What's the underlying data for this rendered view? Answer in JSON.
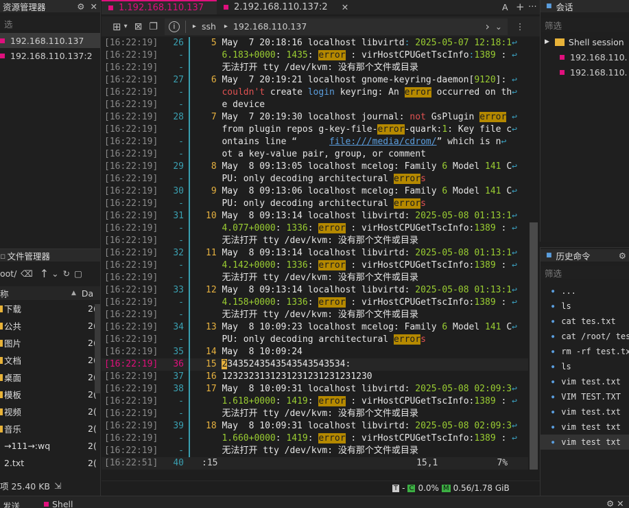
{
  "left_panel": {
    "title": "资源管理器",
    "filter": "选",
    "sessions": [
      "192.168.110.137",
      "192.168.110.137:2"
    ]
  },
  "file_manager": {
    "title": "文件管理器",
    "path": "oot/",
    "col_name": "称",
    "col_date": "Da",
    "items": [
      {
        "name": "下载",
        "date": "2("
      },
      {
        "name": "公共",
        "date": "2("
      },
      {
        "name": "图片",
        "date": "2("
      },
      {
        "name": "文档",
        "date": "2("
      },
      {
        "name": "桌面",
        "date": "2("
      },
      {
        "name": "模板",
        "date": "2("
      },
      {
        "name": "视频",
        "date": "2("
      },
      {
        "name": "音乐",
        "date": "2("
      },
      {
        "name": "→111→:wq",
        "date": "2("
      },
      {
        "name": "2.txt",
        "date": "2("
      }
    ],
    "status": "项 25.40 KB"
  },
  "bottom_tabs": [
    "发送",
    "Shell"
  ],
  "tabs": [
    {
      "label": "1.192.168.110.137",
      "active": true
    },
    {
      "label": "2.192.168.110.137:2",
      "active": false
    }
  ],
  "tab_bar_right": "A",
  "address": {
    "protocol": "ssh",
    "host": "192.168.110.137"
  },
  "terminal": {
    "lines": [
      {
        "ts": "[16:22:19]",
        "ln": "26",
        "html": "<span class='n'> 5</span> May  7 20:18:16 localhost libvirtd<span class='cyan'>:</span> <span class='grn'>2025-05-07 12:18:1</span><span class='wrap'>↩</span>"
      },
      {
        "ts": "[16:22:19]",
        "ln": "-",
        "html": "   <span class='grn'>6.183+0000</span>: <span class='grn'>1435</span>: <span class='er'>error</span> : virHostCPUGetTscInfo<span class='cyan'>:</span><span class='grn'>1389</span> : <span class='wrap'>↩</span>"
      },
      {
        "ts": "[16:22:19]",
        "ln": "-",
        "html": "   无法打开 tty /dev/kvm: 没有那个文件或目录"
      },
      {
        "ts": "[16:22:19]",
        "ln": "27",
        "html": "<span class='n'> 6</span> May  7 20:19:21 localhost gnome-keyring-daemon[<span class='grn'>9120</span>]: <span class='wrap'>↩</span>"
      },
      {
        "ts": "[16:22:19]",
        "ln": "-",
        "html": "   <span class='red'>couldn't</span> create <span class='blu'>login</span> keyring: An <span class='er'>error</span> occurred on th<span class='wrap'>↩</span>"
      },
      {
        "ts": "[16:22:19]",
        "ln": "-",
        "html": "   e device"
      },
      {
        "ts": "[16:22:19]",
        "ln": "28",
        "html": "<span class='n'> 7</span> May  7 20:19:30 localhost journal: <span class='red'>not</span> GsPlugin <span class='er'>error</span> <span class='wrap'>↩</span>"
      },
      {
        "ts": "[16:22:19]",
        "ln": "-",
        "html": "   from plugin repos g-key-file-<span class='er'>error</span>-quark:<span class='grn'>1</span>: Key file c<span class='wrap'>↩</span>"
      },
      {
        "ts": "[16:22:19]",
        "ln": "-",
        "html": "   ontains line “      <span class='link'>file:///media/cdrom/</span>” which is n<span class='wrap'>↩</span>"
      },
      {
        "ts": "[16:22:19]",
        "ln": "-",
        "html": "   ot a key-value pair, group, or comment"
      },
      {
        "ts": "[16:22:19]",
        "ln": "29",
        "html": "<span class='n'> 8</span> May  8 09:13:05 localhost mcelog: Family <span class='grn'>6</span> Model <span class='grn'>141</span> C<span class='wrap'>↩</span>"
      },
      {
        "ts": "[16:22:19]",
        "ln": "-",
        "html": "   PU: only decoding architectural <span class='er'>error</span><span class='red'>s</span>"
      },
      {
        "ts": "[16:22:19]",
        "ln": "30",
        "html": "<span class='n'> 9</span> May  8 09:13:06 localhost mcelog: Family <span class='grn'>6</span> Model <span class='grn'>141</span> C<span class='wrap'>↩</span>"
      },
      {
        "ts": "[16:22:19]",
        "ln": "-",
        "html": "   PU: only decoding architectural <span class='er'>error</span><span class='red'>s</span>"
      },
      {
        "ts": "[16:22:19]",
        "ln": "31",
        "html": "<span class='n'>10</span> May  8 09:13:14 localhost libvirtd: <span class='grn'>2025-05-08 01:13:1</span><span class='wrap'>↩</span>"
      },
      {
        "ts": "[16:22:19]",
        "ln": "-",
        "html": "   <span class='grn'>4.077+0000</span>: <span class='grn'>1336</span>: <span class='er'>error</span> : virHostCPUGetTscInfo:<span class='grn'>1389</span> : <span class='wrap'>↩</span>"
      },
      {
        "ts": "[16:22:19]",
        "ln": "-",
        "html": "   无法打开 tty /dev/kvm: 没有那个文件或目录"
      },
      {
        "ts": "[16:22:19]",
        "ln": "32",
        "html": "<span class='n'>11</span> May  8 09:13:14 localhost libvirtd: <span class='grn'>2025-05-08 01:13:1</span><span class='wrap'>↩</span>"
      },
      {
        "ts": "[16:22:19]",
        "ln": "-",
        "html": "   <span class='grn'>4.142+0000</span>: <span class='grn'>1336</span>: <span class='er'>error</span> : virHostCPUGetTscInfo:<span class='grn'>1389</span> : <span class='wrap'>↩</span>"
      },
      {
        "ts": "[16:22:19]",
        "ln": "-",
        "html": "   无法打开 tty /dev/kvm: 没有那个文件或目录"
      },
      {
        "ts": "[16:22:19]",
        "ln": "33",
        "html": "<span class='n'>12</span> May  8 09:13:14 localhost libvirtd: <span class='grn'>2025-05-08 01:13:1</span><span class='wrap'>↩</span>"
      },
      {
        "ts": "[16:22:19]",
        "ln": "-",
        "html": "   <span class='grn'>4.158+0000</span>: <span class='grn'>1336</span>: <span class='er'>error</span> : virHostCPUGetTscInfo:<span class='grn'>1389</span> : <span class='wrap'>↩</span>"
      },
      {
        "ts": "[16:22:19]",
        "ln": "-",
        "html": "   无法打开 tty /dev/kvm: 没有那个文件或目录"
      },
      {
        "ts": "[16:22:19]",
        "ln": "34",
        "html": "<span class='n'>13</span> May  8 10:09:23 localhost mcelog: Family <span class='grn'>6</span> Model <span class='grn'>141</span> C<span class='wrap'>↩</span>"
      },
      {
        "ts": "[16:22:19]",
        "ln": "-",
        "html": "   PU: only decoding architectural <span class='er'>error</span><span class='red'>s</span>"
      },
      {
        "ts": "[16:22:19]",
        "ln": "35",
        "html": "<span class='n'>14</span> May  8 10:09:24"
      },
      {
        "ts": "[16:22:19]",
        "ln": "36",
        "cur": true,
        "html": "<span class='n'>15</span> <span style='background:#e6b13f;color:#1e1e1e'>2</span>3435243543543543543534:"
      },
      {
        "ts": "[16:22:19]",
        "ln": "37",
        "html": "<span class='n'>16</span> 1232323131231231231231231230"
      },
      {
        "ts": "[16:22:19]",
        "ln": "38",
        "html": "<span class='n'>17</span> May  8 10:09:31 localhost libvirtd: <span class='grn'>2025-05-08 02:09:3</span><span class='wrap'>↩</span>"
      },
      {
        "ts": "[16:22:19]",
        "ln": "-",
        "html": "   <span class='grn'>1.618+0000</span>: <span class='grn'>1419</span>: <span class='er'>error</span> : virHostCPUGetTscInfo:<span class='grn'>1389</span> : <span class='wrap'>↩</span>"
      },
      {
        "ts": "[16:22:19]",
        "ln": "-",
        "html": "   无法打开 tty /dev/kvm: 没有那个文件或目录"
      },
      {
        "ts": "[16:22:19]",
        "ln": "39",
        "html": "<span class='n'>18</span> May  8 10:09:31 localhost libvirtd: <span class='grn'>2025-05-08 02:09:3</span><span class='wrap'>↩</span>"
      },
      {
        "ts": "[16:22:19]",
        "ln": "-",
        "html": "   <span class='grn'>1.660+0000</span>: <span class='grn'>1419</span>: <span class='er'>error</span> : virHostCPUGetTscInfo:<span class='grn'>1389</span> : <span class='wrap'>↩</span>"
      },
      {
        "ts": "[16:22:19]",
        "ln": "-",
        "html": "   无法打开 tty /dev/kvm: 没有那个文件或目录"
      },
      {
        "ts": "[16:22:51]",
        "ln": "40",
        "cmd": true,
        "html": ":15                                     15,1           7%"
      }
    ]
  },
  "status_bar": {
    "cpu": "0.0%",
    "mem": "0.56/1.78 GiB"
  },
  "sessions_panel": {
    "title": "会话",
    "filter": "筛选",
    "folder": "Shell session",
    "items": [
      "192.168.110.",
      "192.168.110."
    ]
  },
  "history_panel": {
    "title": "历史命令",
    "filter": "筛选",
    "items": [
      "...",
      "ls",
      "cat tes.txt",
      "cat /root/ tes",
      "rm -rf test.tx",
      "ls",
      "vim test.txt",
      "VIM TEST.TXT",
      "vim test.txt",
      "vim test txt",
      "vim test txt"
    ]
  }
}
